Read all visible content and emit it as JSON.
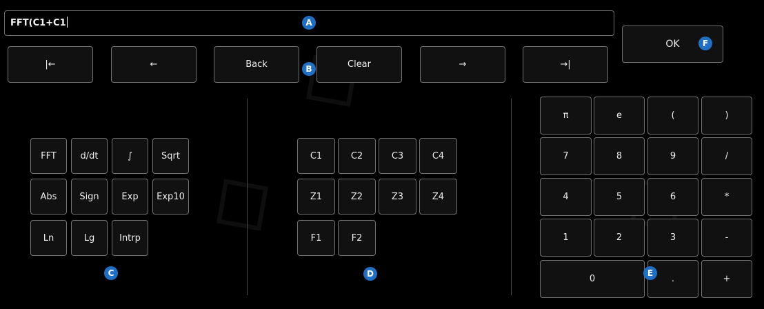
{
  "expression": {
    "value": "FFT(C1+C1"
  },
  "nav": {
    "home": "|←",
    "left": "←",
    "back": "Back",
    "clear": "Clear",
    "right": "→",
    "end": "→|"
  },
  "ok_label": "OK",
  "functions": {
    "row1": [
      "FFT",
      "d/dt",
      "∫",
      "Sqrt"
    ],
    "row2": [
      "Abs",
      "Sign",
      "Exp",
      "Exp10"
    ],
    "row3": [
      "Ln",
      "Lg",
      "Intrp"
    ]
  },
  "sources": {
    "row1": [
      "C1",
      "C2",
      "C3",
      "C4"
    ],
    "row2": [
      "Z1",
      "Z2",
      "Z3",
      "Z4"
    ],
    "row3": [
      "F1",
      "F2"
    ]
  },
  "keypad": {
    "row1": [
      "π",
      "e",
      "(",
      ")"
    ],
    "row2": [
      "7",
      "8",
      "9",
      "/"
    ],
    "row3": [
      "4",
      "5",
      "6",
      "*"
    ],
    "row4": [
      "1",
      "2",
      "3",
      "-"
    ],
    "row5": [
      "0",
      ".",
      "+"
    ]
  },
  "markers": {
    "a": "A",
    "b": "B",
    "c": "C",
    "d": "D",
    "e": "E",
    "f": "F"
  },
  "colors": {
    "background": "#000000",
    "button": "#111111",
    "border": "#737373",
    "marker": "#1f6fc4"
  }
}
